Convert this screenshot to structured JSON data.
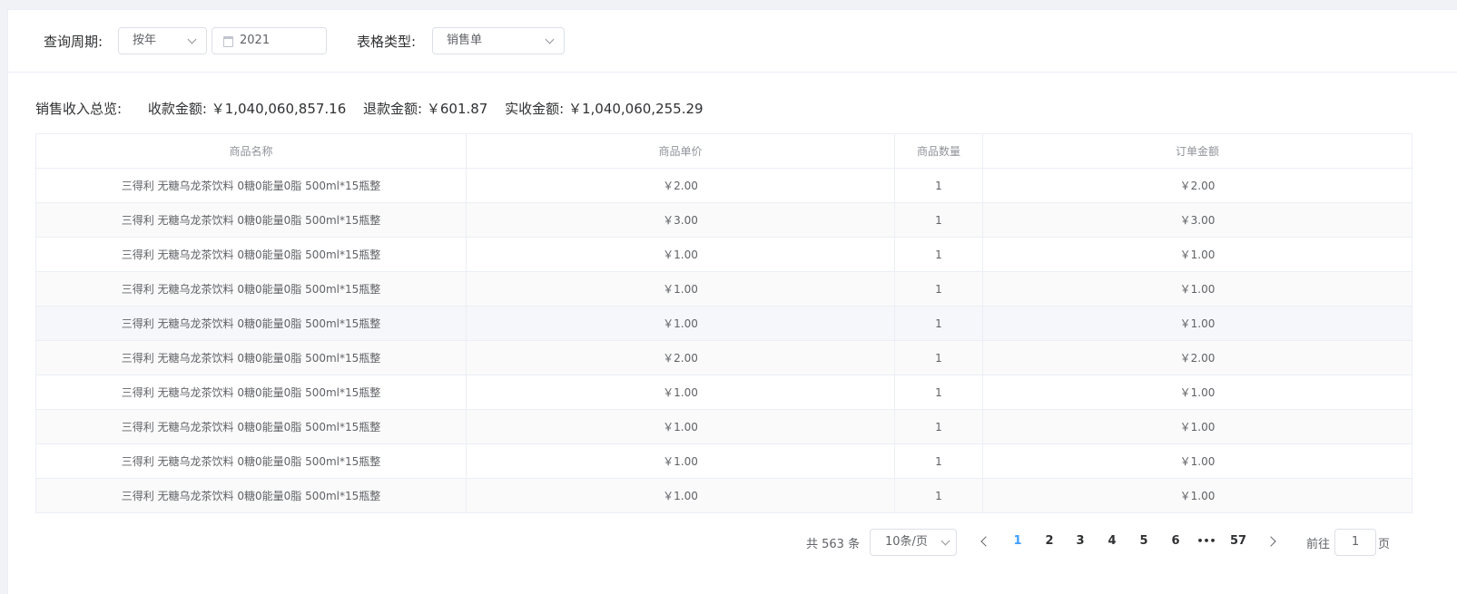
{
  "filters": {
    "period_label": "查询周期:",
    "period_value": "按年",
    "year_value": "2021",
    "table_type_label": "表格类型:",
    "table_type_value": "销售单"
  },
  "summary": {
    "title": "销售收入总览:",
    "received": "收款金额: ￥1,040,060,857.16",
    "refund": "退款金额: ￥601.87",
    "actual": "实收金额: ￥1,040,060,255.29"
  },
  "table": {
    "columns": [
      "商品名称",
      "商品单价",
      "商品数量",
      "订单金额"
    ],
    "rows": [
      [
        "三得利 无糖乌龙茶饮料 0糖0能量0脂 500ml*15瓶整",
        "￥2.00",
        "1",
        "￥2.00"
      ],
      [
        "三得利 无糖乌龙茶饮料 0糖0能量0脂 500ml*15瓶整",
        "￥3.00",
        "1",
        "￥3.00"
      ],
      [
        "三得利 无糖乌龙茶饮料 0糖0能量0脂 500ml*15瓶整",
        "￥1.00",
        "1",
        "￥1.00"
      ],
      [
        "三得利 无糖乌龙茶饮料 0糖0能量0脂 500ml*15瓶整",
        "￥1.00",
        "1",
        "￥1.00"
      ],
      [
        "三得利 无糖乌龙茶饮料 0糖0能量0脂 500ml*15瓶整",
        "￥1.00",
        "1",
        "￥1.00"
      ],
      [
        "三得利 无糖乌龙茶饮料 0糖0能量0脂 500ml*15瓶整",
        "￥2.00",
        "1",
        "￥2.00"
      ],
      [
        "三得利 无糖乌龙茶饮料 0糖0能量0脂 500ml*15瓶整",
        "￥1.00",
        "1",
        "￥1.00"
      ],
      [
        "三得利 无糖乌龙茶饮料 0糖0能量0脂 500ml*15瓶整",
        "￥1.00",
        "1",
        "￥1.00"
      ],
      [
        "三得利 无糖乌龙茶饮料 0糖0能量0脂 500ml*15瓶整",
        "￥1.00",
        "1",
        "￥1.00"
      ],
      [
        "三得利 无糖乌龙茶饮料 0糖0能量0脂 500ml*15瓶整",
        "￥1.00",
        "1",
        "￥1.00"
      ]
    ]
  },
  "pagination": {
    "total": "共 563 条",
    "page_size": "10条/页",
    "pages": [
      "1",
      "2",
      "3",
      "4",
      "5",
      "6",
      "•••",
      "57"
    ],
    "current": "1",
    "goto_prefix": "前往",
    "goto_value": "1",
    "goto_suffix": "页",
    "active_color": "#409eff"
  }
}
